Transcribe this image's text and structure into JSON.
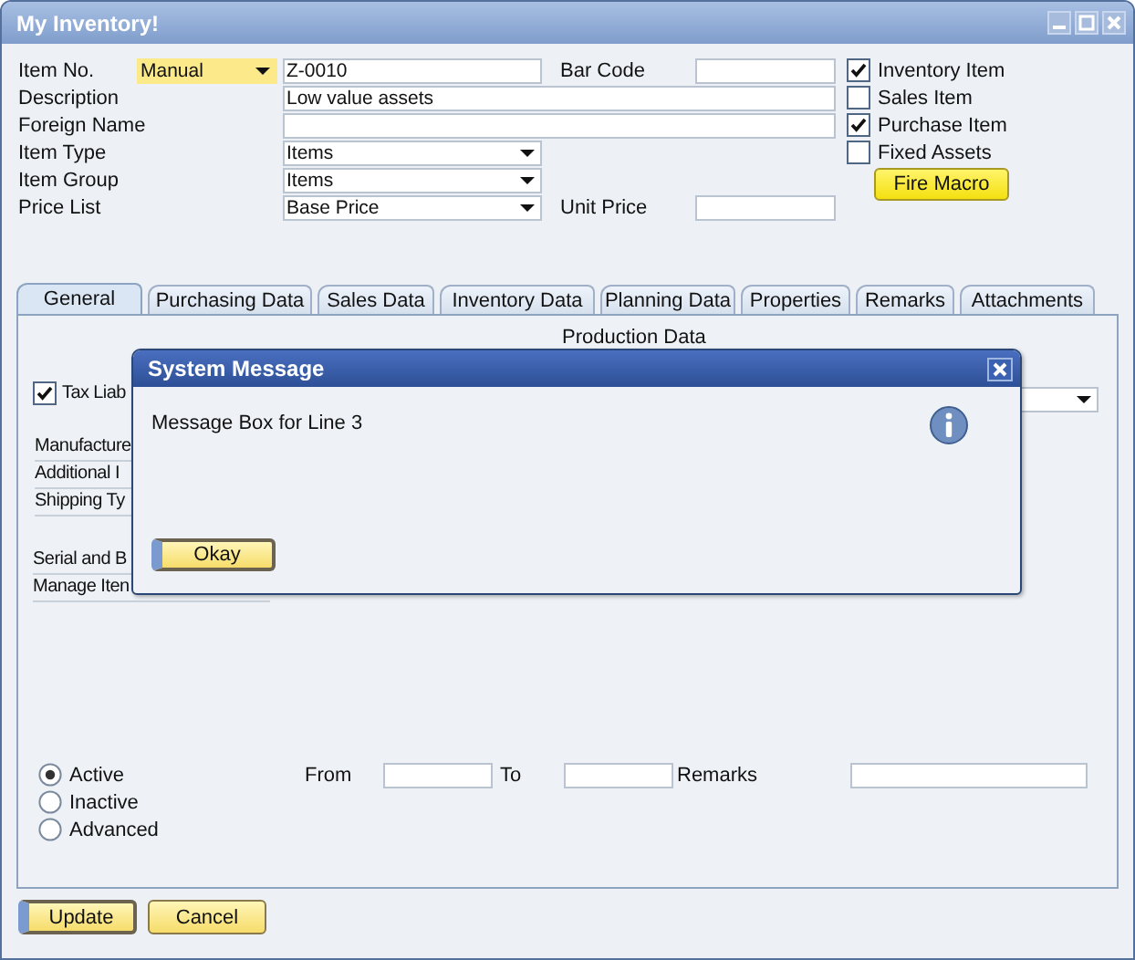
{
  "window": {
    "title": "My Inventory!"
  },
  "header": {
    "rows": [
      {
        "kind": "series",
        "label": "Item No.",
        "series": "Manual",
        "value": "Z-0010",
        "side": {
          "label": "Bar Code"
        }
      },
      {
        "kind": "text",
        "label": "Description",
        "value": "Low value assets"
      },
      {
        "kind": "text",
        "label": "Foreign Name"
      },
      {
        "kind": "select",
        "label": "Item Type",
        "value": "Items"
      },
      {
        "kind": "select",
        "label": "Item Group",
        "value": "Items"
      },
      {
        "kind": "select",
        "label": "Price List",
        "value": "Base Price",
        "side": {
          "label": "Unit Price"
        }
      }
    ],
    "checkboxes": [
      {
        "label": "Inventory Item",
        "checked": true
      },
      {
        "label": "Sales Item",
        "checked": false
      },
      {
        "label": "Purchase Item",
        "checked": true
      },
      {
        "label": "Fixed Assets",
        "checked": false
      }
    ],
    "macro_button": "Fire Macro"
  },
  "tabs": [
    {
      "label": "General",
      "selected": true
    },
    {
      "label": "Purchasing Data",
      "selected": false
    },
    {
      "label": "Sales Data",
      "selected": false
    },
    {
      "label": "Inventory Data",
      "selected": false
    },
    {
      "label": "Planning Data",
      "selected": false
    },
    {
      "label": "Properties",
      "selected": false
    },
    {
      "label": "Remarks",
      "selected": false
    },
    {
      "label": "Attachments",
      "selected": false
    }
  ],
  "general_tab": {
    "section_title": "Production Data",
    "tax_liable": {
      "label": "Tax Liab",
      "checked": true
    },
    "labels": [
      "Manufacture",
      "Additional I",
      "Shipping Ty"
    ],
    "serial_link": "Serial and B",
    "manage_label": "Manage Iten",
    "status": [
      {
        "label": "Active",
        "selected": true
      },
      {
        "label": "Inactive",
        "selected": false
      },
      {
        "label": "Advanced",
        "selected": false
      }
    ],
    "period": {
      "from": "From",
      "to": "To",
      "remarks": "Remarks"
    }
  },
  "buttons": [
    {
      "label": "Update",
      "default": true
    },
    {
      "label": "Cancel",
      "default": false
    }
  ],
  "dialog": {
    "title": "System Message",
    "message": "Message Box for Line 3",
    "buttons": [
      {
        "label": "Okay",
        "default": true
      }
    ]
  }
}
